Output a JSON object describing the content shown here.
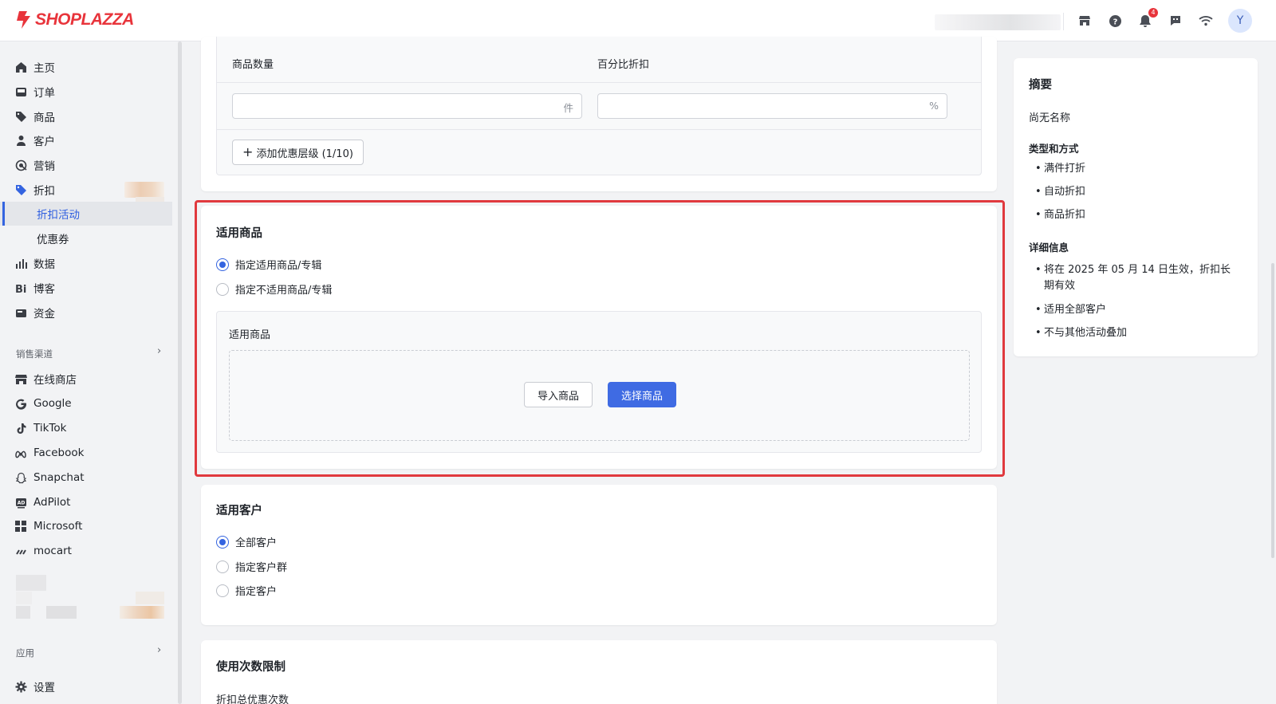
{
  "header": {
    "brand": "SHOPLAZZA",
    "notification_count": "4",
    "avatar_initial": "Y"
  },
  "sidebar": {
    "items": [
      {
        "label": "主页",
        "icon": "home-icon"
      },
      {
        "label": "订单",
        "icon": "inbox-icon"
      },
      {
        "label": "商品",
        "icon": "tag-icon"
      },
      {
        "label": "客户",
        "icon": "person-icon"
      },
      {
        "label": "营销",
        "icon": "target-icon"
      },
      {
        "label": "折扣",
        "icon": "discount-icon"
      }
    ],
    "discount_sub": [
      {
        "label": "折扣活动",
        "active": true
      },
      {
        "label": "优惠券",
        "active": false
      }
    ],
    "items2": [
      {
        "label": "数据",
        "icon": "bar-chart-icon"
      },
      {
        "label": "博客",
        "icon": "blog-icon"
      },
      {
        "label": "资金",
        "icon": "wallet-icon"
      }
    ],
    "sales_channels_label": "销售渠道",
    "channels": [
      {
        "label": "在线商店",
        "icon": "store-icon"
      },
      {
        "label": "Google",
        "icon": "google-icon"
      },
      {
        "label": "TikTok",
        "icon": "tiktok-icon"
      },
      {
        "label": "Facebook",
        "icon": "meta-icon"
      },
      {
        "label": "Snapchat",
        "icon": "snapchat-icon"
      },
      {
        "label": "AdPilot",
        "icon": "ad-icon"
      },
      {
        "label": "Microsoft",
        "icon": "microsoft-icon"
      },
      {
        "label": "mocart",
        "icon": "mocart-icon"
      }
    ],
    "apps_label": "应用",
    "settings_label": "设置"
  },
  "tier_card": {
    "col_quantity": "商品数量",
    "col_percent": "百分比折扣",
    "quantity_value": "",
    "quantity_suffix": "件",
    "percent_value": "",
    "percent_suffix": "%",
    "add_tier_label": "添加优惠层级 (1/10)"
  },
  "products_card": {
    "title": "适用商品",
    "option_include": "指定适用商品/专辑",
    "option_exclude": "指定不适用商品/专辑",
    "selected": "include",
    "box_title": "适用商品",
    "import_label": "导入商品",
    "select_label": "选择商品"
  },
  "customers_card": {
    "title": "适用客户",
    "options": [
      "全部客户",
      "指定客户群",
      "指定客户"
    ],
    "selected_index": 0
  },
  "usage_card": {
    "title": "使用次数限制",
    "total_label": "折扣总优惠次数"
  },
  "summary": {
    "title": "摘要",
    "name": "尚无名称",
    "type_heading": "类型和方式",
    "type_items": [
      "满件打折",
      "自动折扣",
      "商品折扣"
    ],
    "detail_heading": "详细信息",
    "detail_items": [
      "将在 2025 年 05 月 14 日生效，折扣长期有效",
      "适用全部客户",
      "不与其他活动叠加"
    ]
  },
  "colors": {
    "brand": "#e8343b",
    "primary": "#3f6be3",
    "highlight": "#e0393e"
  }
}
